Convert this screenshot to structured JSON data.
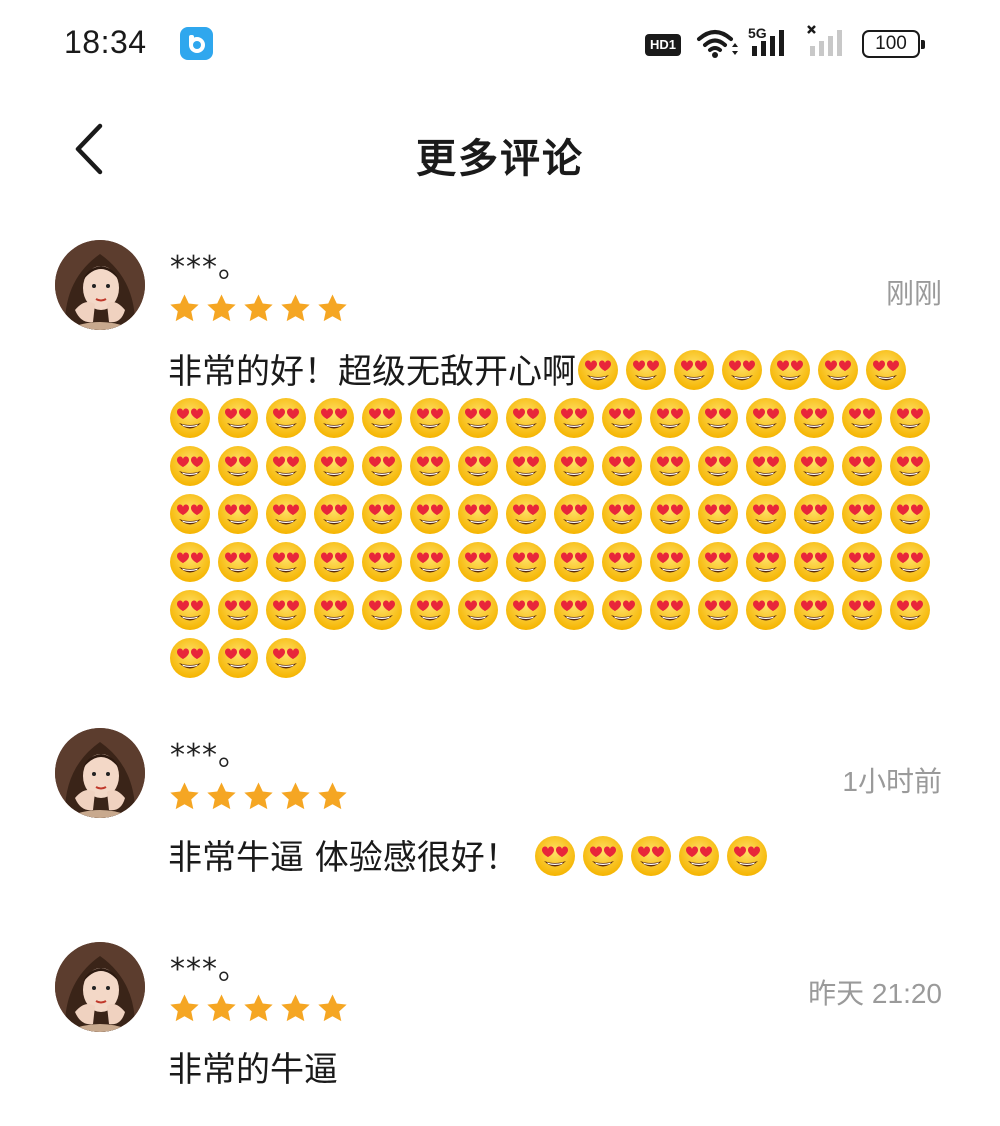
{
  "status_bar": {
    "time": "18:34",
    "hd_label": "HD1",
    "network_label": "5G",
    "battery": "100",
    "icons": [
      "app-badge-icon",
      "hd-icon",
      "wifi-icon",
      "signal-5g-icon",
      "signal-no-service-icon",
      "battery-icon"
    ]
  },
  "header": {
    "back_icon": "chevron-left-icon",
    "title": "更多评论"
  },
  "colors": {
    "star": "#f5a623",
    "timestamp": "#9a9a9a",
    "app_badge": "#2fa7ee"
  },
  "comments": [
    {
      "username": "***。",
      "rating": 5,
      "time": "刚刚",
      "text": "非常的好！超级无敌开心啊",
      "emoji": "smiling-face-with-heart-eyes",
      "emoji_count": 90
    },
    {
      "username": "***。",
      "rating": 5,
      "time": "1小时前",
      "text": "非常牛逼 体验感很好！",
      "emoji": "smiling-face-with-heart-eyes",
      "emoji_count": 5
    },
    {
      "username": "***。",
      "rating": 5,
      "time": "昨天 21:20",
      "text": "非常的牛逼",
      "emoji": "",
      "emoji_count": 0
    }
  ]
}
